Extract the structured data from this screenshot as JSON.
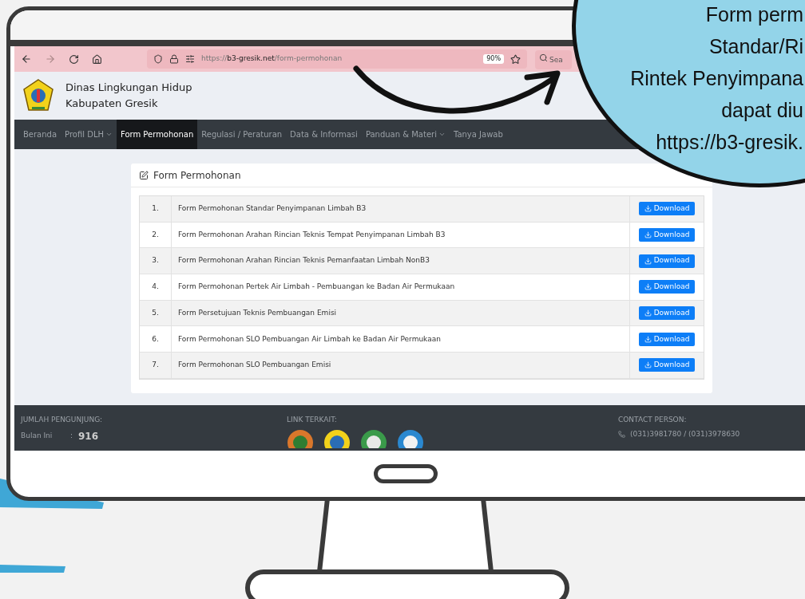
{
  "browser": {
    "url": {
      "scheme": "https://",
      "host": "b3-gresik.net",
      "path": "/form-permohonan"
    },
    "zoom": "90%",
    "search": {
      "placeholder": "Sea"
    },
    "forward_disabled": true
  },
  "site": {
    "title_lines": [
      "Dinas Lingkungan Hidup",
      "Kabupaten Gresik"
    ],
    "nav": [
      {
        "label": "Beranda",
        "selected": false,
        "dropdown": false
      },
      {
        "label": "Profil DLH",
        "selected": false,
        "dropdown": true
      },
      {
        "label": "Form Permohonan",
        "selected": true,
        "dropdown": false
      },
      {
        "label": "Regulasi / Peraturan",
        "selected": false,
        "dropdown": false
      },
      {
        "label": "Data & Informasi",
        "selected": false,
        "dropdown": false
      },
      {
        "label": "Panduan & Materi",
        "selected": false,
        "dropdown": true
      },
      {
        "label": "Tanya Jawab",
        "selected": false,
        "dropdown": false
      }
    ]
  },
  "card": {
    "title": "Form Permohonan",
    "rows": [
      {
        "no": "1.",
        "name": "Form Permohonan Standar Penyimpanan Limbah B3",
        "button": "Download"
      },
      {
        "no": "2.",
        "name": "Form Permohonan Arahan Rincian Teknis Tempat Penyimpanan Limbah B3",
        "button": "Download"
      },
      {
        "no": "3.",
        "name": "Form Permohonan Arahan Rincian Teknis Pemanfaatan Limbah NonB3",
        "button": "Download"
      },
      {
        "no": "4.",
        "name": "Form Permohonan Pertek Air Limbah - Pembuangan ke Badan Air Permukaan",
        "button": "Download"
      },
      {
        "no": "5.",
        "name": "Form Persetujuan Teknis Pembuangan Emisi",
        "button": "Download"
      },
      {
        "no": "6.",
        "name": "Form Permohonan SLO Pembuangan Air Limbah ke Badan Air Permukaan",
        "button": "Download"
      },
      {
        "no": "7.",
        "name": "Form Permohonan SLO Pembuangan Emisi",
        "button": "Download"
      }
    ]
  },
  "footer": {
    "visitors": {
      "heading": "JUMLAH PENGUNJUNG:",
      "label": "Bulan Ini",
      "separator": ":",
      "value": "916"
    },
    "links": {
      "heading": "LINK TERKAIT:"
    },
    "contact": {
      "heading": "CONTACT PERSON:",
      "phone": "(031)3981780 / (031)3978630"
    }
  },
  "callout": {
    "lines": [
      "Form perm",
      "Standar/Ri",
      "Rintek Penyimpana",
      "dapat diu",
      "https://b3-gresik."
    ]
  }
}
